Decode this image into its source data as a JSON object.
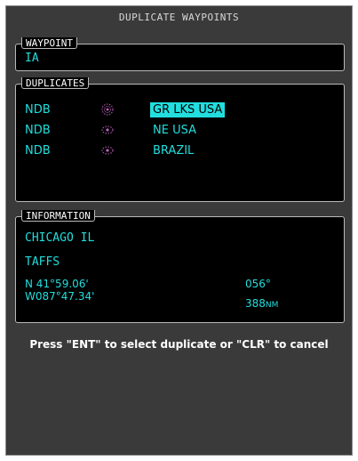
{
  "window": {
    "title": "DUPLICATE WAYPOINTS"
  },
  "waypoint_box": {
    "label": "WAYPOINT",
    "value": "IA"
  },
  "duplicates_box": {
    "label": "DUPLICATES",
    "rows": [
      {
        "type": "NDB",
        "icon": "ndb-symbol-icon",
        "region": "GR LKS USA",
        "selected": true
      },
      {
        "type": "NDB",
        "icon": "ndb-symbol-icon",
        "region": "NE USA",
        "selected": false
      },
      {
        "type": "NDB",
        "icon": "ndb-symbol-icon",
        "region": "BRAZIL",
        "selected": false
      }
    ]
  },
  "information_box": {
    "label": "INFORMATION",
    "city": "CHICAGO IL",
    "name": "TAFFS",
    "latitude": "N 41°59.06'",
    "longitude": "W087°47.34'",
    "bearing": "056°",
    "distance_value": "388",
    "distance_unit": "NM"
  },
  "prompt": {
    "text": "Press \"ENT\" to select duplicate or \"CLR\" to cancel"
  },
  "colors": {
    "screen_bg": "#3a3a3a",
    "box_bg": "#000000",
    "cyan_text": "#22dede",
    "white_text": "#ffffff",
    "ndb_symbol": "#c060c0"
  }
}
